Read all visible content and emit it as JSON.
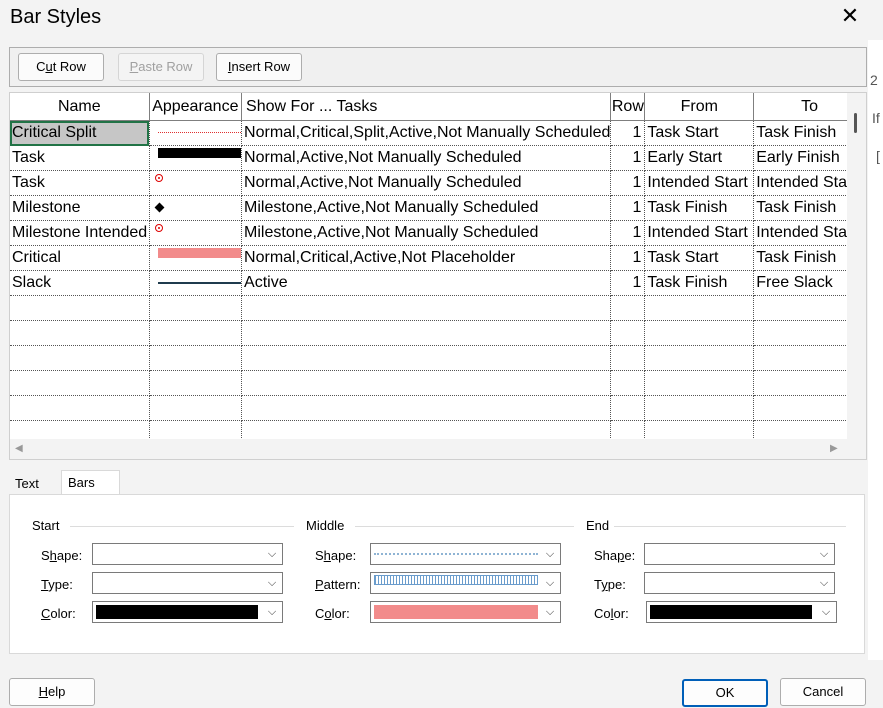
{
  "window": {
    "title": "Bar Styles"
  },
  "toolbar": {
    "cut_pre": "C",
    "cut_mn": "u",
    "cut_post": "t Row",
    "paste_pre": "",
    "paste_mn": "P",
    "paste_post": "aste Row",
    "insert_pre": "",
    "insert_mn": "I",
    "insert_post": "nsert Row"
  },
  "grid": {
    "columns": [
      "Name",
      "Appearance",
      "Show For ... Tasks",
      "Row",
      "From",
      "To"
    ],
    "rows": [
      {
        "name": "Critical Split",
        "appearance": "dotted-red-line",
        "show_for": "Normal,Critical,Split,Active,Not Manually Scheduled",
        "row": "1",
        "from": "Task Start",
        "to": "Task Finish"
      },
      {
        "name": "Task",
        "appearance": "black-bar",
        "show_for": "Normal,Active,Not Manually Scheduled",
        "row": "1",
        "from": "Early Start",
        "to": "Early Finish"
      },
      {
        "name": "Task",
        "appearance": "red-circle",
        "show_for": "Normal,Active,Not Manually Scheduled",
        "row": "1",
        "from": "Intended Start",
        "to": "Intended Start"
      },
      {
        "name": "Milestone",
        "appearance": "black-diamond",
        "show_for": "Milestone,Active,Not Manually Scheduled",
        "row": "1",
        "from": "Task Finish",
        "to": "Task Finish"
      },
      {
        "name": "Milestone Intended",
        "appearance": "red-circle",
        "show_for": "Milestone,Active,Not Manually Scheduled",
        "row": "1",
        "from": "Intended Start",
        "to": "Intended Start"
      },
      {
        "name": "Critical",
        "appearance": "salmon-bar",
        "show_for": "Normal,Critical,Active,Not Placeholder",
        "row": "1",
        "from": "Task Start",
        "to": "Task Finish"
      },
      {
        "name": "Slack",
        "appearance": "navy-line",
        "show_for": "Active",
        "row": "1",
        "from": "Task Finish",
        "to": "Free Slack"
      }
    ]
  },
  "tabs": {
    "text": "Text",
    "bars": "Bars",
    "active": "Bars"
  },
  "bars": {
    "start": {
      "label": "Start",
      "shape_pre": "S",
      "shape_mn": "h",
      "shape_post": "ape:",
      "type_pre": "",
      "type_mn": "T",
      "type_post": "ype:",
      "color_pre": "",
      "color_mn": "C",
      "color_post": "olor:",
      "color_value": "#000000"
    },
    "middle": {
      "label": "Middle",
      "shape_pre": "S",
      "shape_mn": "h",
      "shape_post": "ape:",
      "pattern_pre": "",
      "pattern_mn": "P",
      "pattern_post": "attern:",
      "color_pre": "C",
      "color_mn": "o",
      "color_post": "lor:",
      "color_value": "#f28b8b"
    },
    "end": {
      "label": "End",
      "shape_pre": "Sha",
      "shape_mn": "p",
      "shape_post": "e:",
      "type_pre": "T",
      "type_mn": "y",
      "type_post": "pe:",
      "color_pre": "Co",
      "color_mn": "l",
      "color_post": "or:",
      "color_value": "#000000"
    }
  },
  "footer": {
    "help_pre": "",
    "help_mn": "H",
    "help_post": "elp",
    "ok": "OK",
    "cancel": "Cancel"
  },
  "colors": {
    "selection_outline": "#217346",
    "default_button": "#005fb8"
  }
}
